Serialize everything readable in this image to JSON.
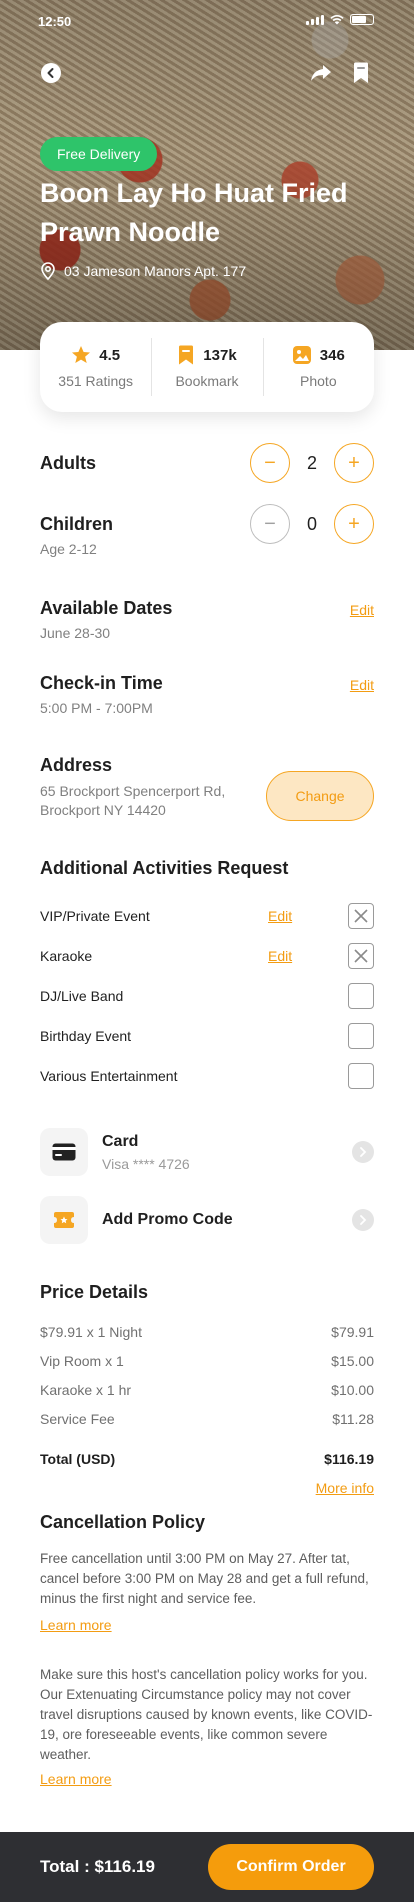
{
  "status_bar": {
    "time": "12:50"
  },
  "hero": {
    "badge": "Free Delivery",
    "title": "Boon Lay Ho Huat Fried Prawn Noodle",
    "address": "03 Jameson Manors Apt. 177"
  },
  "stats": [
    {
      "icon": "star-icon",
      "value": "4.5",
      "label": "351 Ratings"
    },
    {
      "icon": "bookmark-icon",
      "value": "137k",
      "label": "Bookmark"
    },
    {
      "icon": "photo-icon",
      "value": "346",
      "label": "Photo"
    }
  ],
  "guests": {
    "adults": {
      "label": "Adults",
      "value": "2"
    },
    "children": {
      "label": "Children",
      "sub": "Age 2-12",
      "value": "0"
    }
  },
  "dates": {
    "label": "Available Dates",
    "value": "June 28-30",
    "edit": "Edit"
  },
  "checkin": {
    "label": "Check-in Time",
    "value": "5:00 PM - 7:00PM",
    "edit": "Edit"
  },
  "address": {
    "label": "Address",
    "line1": "65 Brockport Spencerport Rd,",
    "line2": "Brockport NY 14420",
    "change": "Change"
  },
  "activities": {
    "title": "Additional Activities Request",
    "items": [
      {
        "label": "VIP/Private Event",
        "edit": "Edit",
        "checked": true
      },
      {
        "label": "Karaoke",
        "edit": "Edit",
        "checked": true
      },
      {
        "label": "DJ/Live Band",
        "checked": false
      },
      {
        "label": "Birthday Event",
        "checked": false
      },
      {
        "label": "Various Entertainment",
        "checked": false
      }
    ]
  },
  "payment": {
    "card_title": "Card",
    "card_sub": "Visa **** 4726",
    "promo_title": "Add Promo Code"
  },
  "price": {
    "title": "Price Details",
    "rows": [
      {
        "label": "$79.91 x 1 Night",
        "amount": "$79.91"
      },
      {
        "label": "Vip Room x 1",
        "amount": "$15.00"
      },
      {
        "label": "Karaoke x 1 hr",
        "amount": "$10.00"
      },
      {
        "label": "Service Fee",
        "amount": "$11.28"
      }
    ],
    "total_label": "Total (USD)",
    "total_amount": "$116.19",
    "more_info": "More info"
  },
  "cancellation": {
    "title": "Cancellation Policy",
    "para1": "Free cancellation until 3:00 PM on May 27. After tat, cancel before 3:00 PM on May 28 and get a full refund, minus the first night and service fee.",
    "para2": "Make sure this host's cancellation policy works for you. Our Extenuating Circumstance policy may not cover travel disruptions caused by known events, like COVID-19, ore foreseeable events, like common severe weather.",
    "learn_more": "Learn more"
  },
  "footer": {
    "total": "Total : $116.19",
    "confirm": "Confirm Order"
  },
  "colors": {
    "accent": "#f5a623",
    "badge": "#2ec46a",
    "bottom_bar": "#2e2f33"
  }
}
